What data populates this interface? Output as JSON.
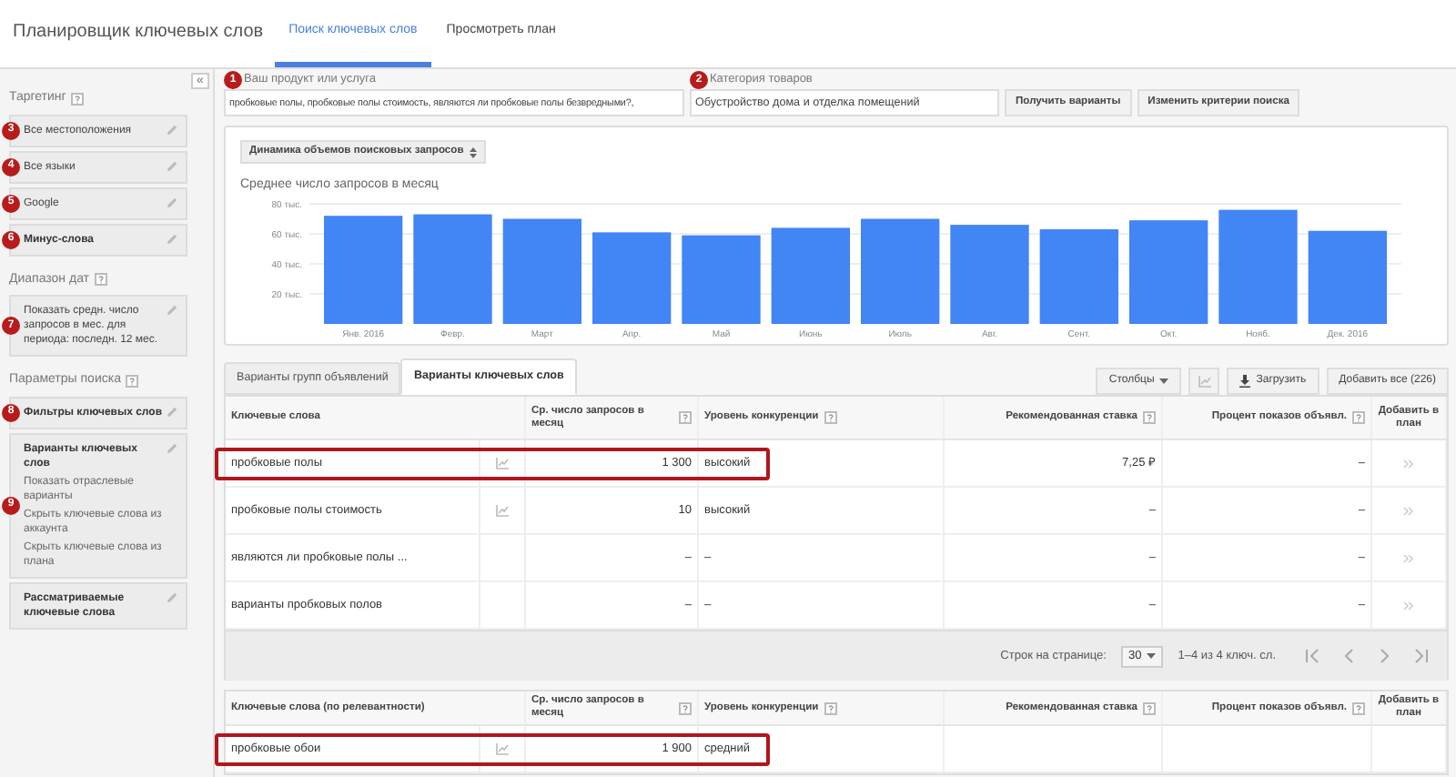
{
  "header": {
    "title": "Планировщик ключевых слов",
    "tabs": [
      {
        "label": "Поиск ключевых слов",
        "selected": true
      },
      {
        "label": "Просмотреть план",
        "selected": false
      }
    ]
  },
  "sidebar": {
    "collapse": "«",
    "sections": [
      {
        "title": "Таргетинг",
        "help": true,
        "items": [
          {
            "badge": "3",
            "label": "Все местоположения",
            "bold": false
          },
          {
            "badge": "4",
            "label": "Все языки",
            "bold": false
          },
          {
            "badge": "5",
            "label": "Google",
            "bold": false
          },
          {
            "badge": "6",
            "label": "Минус-слова",
            "bold": true
          }
        ]
      },
      {
        "title": "Диапазон дат",
        "help": true,
        "items": [
          {
            "badge": "7",
            "label": "Показать средн. число запросов в мес. для периода: последн. 12 мес.",
            "bold": false
          }
        ]
      },
      {
        "title": "Параметры поиска",
        "help": true,
        "items": [
          {
            "badge": "8",
            "label": "Фильтры ключевых слов",
            "bold": true
          },
          {
            "badge": "9",
            "label": "Варианты ключевых слов",
            "bold": true,
            "options": [
              "Показать отраслевые варианты",
              "Скрыть ключевые слова из аккаунта",
              "Скрыть ключевые слова из плана"
            ]
          },
          {
            "label": "Рассматриваемые ключевые слова",
            "bold": true
          }
        ]
      }
    ]
  },
  "search": {
    "product": {
      "badge": "1",
      "label": "Ваш продукт или услуга",
      "value": "пробковые полы, пробковые полы стоимость, являются ли пробковые полы безвредными?,"
    },
    "category": {
      "badge": "2",
      "label": "Категория товаров",
      "value": "Обустройство дома и отделка помещений"
    },
    "buttons": [
      "Получить варианты",
      "Изменить критерии поиска"
    ]
  },
  "chart_panel": {
    "selector": "Динамика объемов поисковых запросов",
    "chart_data": {
      "type": "bar",
      "title": "Среднее число запросов в месяц",
      "categories": [
        "Янв. 2016",
        "Февр.",
        "Март",
        "Апр.",
        "Май",
        "Июнь",
        "Июль",
        "Авг.",
        "Сент.",
        "Окт.",
        "Нояб.",
        "Дек. 2016"
      ],
      "values": [
        72,
        73,
        70,
        61,
        59,
        64,
        70,
        66,
        63,
        69,
        76,
        62
      ],
      "grid": true,
      "ylim": [
        0,
        80
      ],
      "yticks": [
        {
          "value": 20,
          "label": "20 тыс."
        },
        {
          "value": 40,
          "label": "40 тыс."
        },
        {
          "value": 60,
          "label": "60 тыс."
        },
        {
          "value": 80,
          "label": "80 тыс."
        }
      ]
    }
  },
  "result_tabs": [
    {
      "label": "Варианты групп объявлений",
      "selected": false
    },
    {
      "label": "Варианты ключевых слов",
      "selected": true
    }
  ],
  "toolbar": {
    "columns": "Столбцы",
    "download": "Загрузить",
    "add_all": "Добавить все (226)"
  },
  "table": {
    "columns": [
      {
        "label": "Ключевые слова",
        "help": false
      },
      {
        "label": "Ср. число запросов в месяц",
        "help": true
      },
      {
        "label": "Уровень конкуренции",
        "help": true
      },
      {
        "label": "Рекомендованная ставка",
        "help": true
      },
      {
        "label": "Процент показов объявл.",
        "help": true
      },
      {
        "label": "Добавить в план",
        "help": false
      }
    ],
    "rows": [
      {
        "keyword": "пробковые полы",
        "trend": true,
        "avg": "1 300",
        "competition": "высокий",
        "bid": "7,25 ₽",
        "share": "–",
        "highlighted": true
      },
      {
        "keyword": "пробковые полы стоимость",
        "trend": true,
        "avg": "10",
        "competition": "высокий",
        "bid": "–",
        "share": "–",
        "highlighted": false
      },
      {
        "keyword": "являются ли пробковые полы ...",
        "trend": false,
        "avg": "–",
        "competition": "–",
        "bid": "–",
        "share": "–",
        "highlighted": false
      },
      {
        "keyword": "варианты пробковых полов",
        "trend": false,
        "avg": "–",
        "competition": "–",
        "bid": "–",
        "share": "–",
        "highlighted": false
      }
    ]
  },
  "pagination": {
    "label": "Строк на странице:",
    "per_page": "30",
    "range": "1–4 из 4 ключ. сл."
  },
  "table2": {
    "columns": [
      {
        "label": "Ключевые слова (по релевантности)",
        "help": false
      },
      {
        "label": "Ср. число запросов в месяц",
        "help": true
      },
      {
        "label": "Уровень конкуренции",
        "help": true
      },
      {
        "label": "Рекомендованная ставка",
        "help": true
      },
      {
        "label": "Процент показов объявл.",
        "help": true
      },
      {
        "label": "Добавить в план",
        "help": false
      }
    ],
    "rows": [
      {
        "keyword": "пробковые обои",
        "trend": true,
        "avg": "1 900",
        "competition": "средний",
        "highlighted": true
      }
    ]
  }
}
